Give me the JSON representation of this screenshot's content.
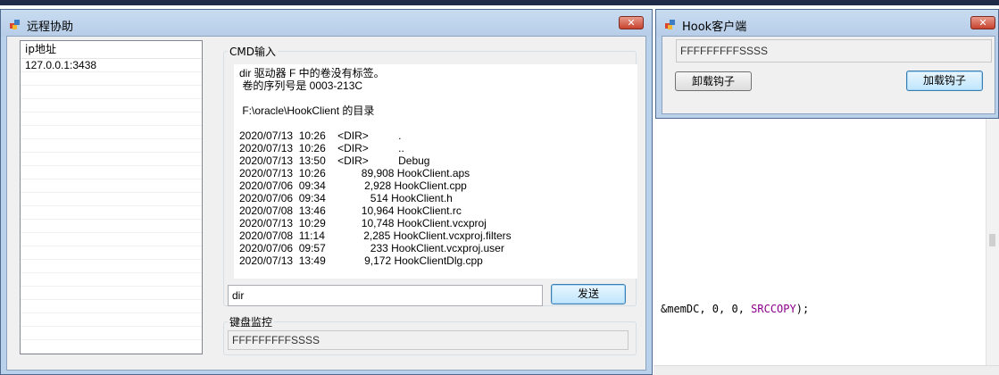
{
  "background": {
    "code_prefix": "&memDC, 0, 0, ",
    "code_keyword": "SRCCOPY",
    "code_suffix": ");"
  },
  "remote_window": {
    "title": "远程协助",
    "close_glyph": "✕",
    "ip_list": {
      "header": "ip地址",
      "items": [
        "127.0.0.1:3438"
      ]
    },
    "cmd_group": {
      "label": "CMD输入",
      "output": "dir 驱动器 F 中的卷没有标签。\n 卷的序列号是 0003-213C\n\n F:\\oracle\\HookClient 的目录\n\n2020/07/13  10:26    <DIR>          .\n2020/07/13  10:26    <DIR>          ..\n2020/07/13  13:50    <DIR>          Debug\n2020/07/13  10:26            89,908 HookClient.aps\n2020/07/06  09:34             2,928 HookClient.cpp\n2020/07/06  09:34               514 HookClient.h\n2020/07/08  13:46            10,964 HookClient.rc\n2020/07/13  10:29            10,748 HookClient.vcxproj\n2020/07/08  11:14             2,285 HookClient.vcxproj.filters\n2020/07/06  09:57               233 HookClient.vcxproj.user\n2020/07/13  13:49             9,172 HookClientDlg.cpp",
      "input_value": "dir",
      "send_label": "发送"
    },
    "keyboard_group": {
      "label": "键盘监控",
      "value": "FFFFFFFFFSSSS"
    }
  },
  "hook_window": {
    "title": "Hook客户端",
    "close_glyph": "✕",
    "field_value": "FFFFFFFFFSSSS",
    "unload_label": "卸载钩子",
    "load_label": "加载钩子"
  }
}
